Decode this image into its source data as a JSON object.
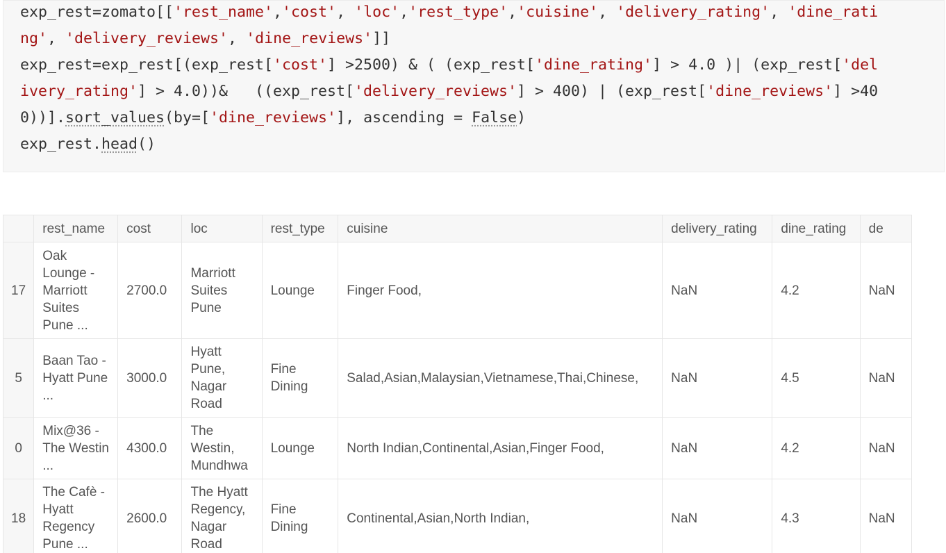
{
  "code": {
    "line1": {
      "prefix": "exp_rest=zomato[[",
      "s1": "'rest_name'",
      "sep1": ",",
      "s2": "'cost'",
      "sep2": ", ",
      "s3": "'loc'",
      "sep3": ",",
      "s4": "'rest_type'",
      "sep4": ",",
      "s5": "'cuisine'",
      "sep5": ", ",
      "s6": "'delivery_rating'",
      "sep6": ", ",
      "s7": "'dine_rati"
    },
    "line2": {
      "s1": "ng'",
      "sep1": ", ",
      "s2": "'delivery_reviews'",
      "sep2": ", ",
      "s3": "'dine_reviews'",
      "suffix": "]]"
    },
    "line3": {
      "prefix": "exp_rest=exp_rest[(exp_rest[",
      "s1": "'cost'",
      "mid1": "] >2500) & ( (exp_rest[",
      "s2": "'dine_rating'",
      "mid2": "] > 4.0 )| (exp_rest[",
      "s3": "'del"
    },
    "line4": {
      "s1": "ivery_rating'",
      "mid1": "] > 4.0))&   ((exp_rest[",
      "s2": "'delivery_reviews'",
      "mid2": "] > 400) | (exp_rest[",
      "s3": "'dine_reviews'",
      "suffix": "] >40"
    },
    "line5": {
      "prefix": "0))].",
      "method": "sort_values",
      "mid1": "(by=[",
      "s1": "'dine_reviews'",
      "mid2": "], ascending = ",
      "kw": "False",
      "suffix": ")"
    },
    "line6": {
      "prefix": "exp_rest.",
      "method": "head",
      "suffix": "()"
    }
  },
  "table": {
    "columns": [
      "",
      "rest_name",
      "cost",
      "loc",
      "rest_type",
      "cuisine",
      "delivery_rating",
      "dine_rating",
      "de"
    ],
    "rows": [
      {
        "index": "17",
        "rest_name": "Oak Lounge - Marriott Suites Pune ...",
        "cost": "2700.0",
        "loc": "Marriott Suites Pune",
        "rest_type": "Lounge",
        "cuisine": "Finger Food,",
        "delivery_rating": "NaN",
        "dine_rating": "4.2",
        "extra": "NaN"
      },
      {
        "index": "5",
        "rest_name": "Baan Tao - Hyatt Pune ...",
        "cost": "3000.0",
        "loc": "Hyatt Pune, Nagar Road",
        "rest_type": "Fine Dining",
        "cuisine": "Salad,Asian,Malaysian,Vietnamese,Thai,Chinese,",
        "delivery_rating": "NaN",
        "dine_rating": "4.5",
        "extra": "NaN"
      },
      {
        "index": "0",
        "rest_name": "Mix@36 - The Westin ...",
        "cost": "4300.0",
        "loc": "The Westin, Mundhwa",
        "rest_type": "Lounge",
        "cuisine": "North Indian,Continental,Asian,Finger Food,",
        "delivery_rating": "NaN",
        "dine_rating": "4.2",
        "extra": "NaN"
      },
      {
        "index": "18",
        "rest_name": "The Cafè - Hyatt Regency Pune ...",
        "cost": "2600.0",
        "loc": "The Hyatt Regency, Nagar Road",
        "rest_type": "Fine Dining",
        "cuisine": "Continental,Asian,North Indian,",
        "delivery_rating": "NaN",
        "dine_rating": "4.3",
        "extra": "NaN"
      }
    ]
  }
}
